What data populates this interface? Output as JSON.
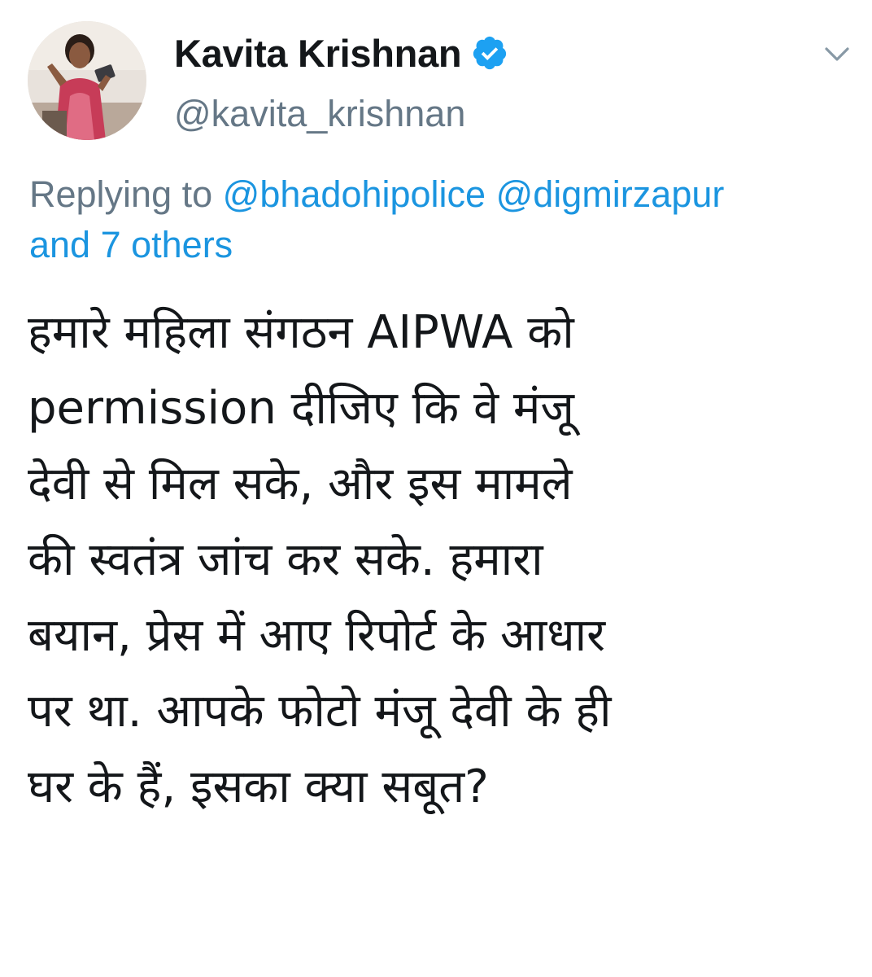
{
  "author": {
    "display_name": "Kavita Krishnan",
    "handle": "@kavita_krishnan",
    "verified": true,
    "avatar_icon": "profile-photo-avatar"
  },
  "menu": {
    "icon": "chevron-down-icon"
  },
  "reply_context": {
    "prefix": "Replying to",
    "mentions": [
      "@bhadohipolice",
      "@digmirzapur"
    ],
    "others": "and 7 others"
  },
  "tweet": {
    "lines": [
      "हमारे महिला संगठन AIPWA को",
      "permission दीजिए कि वे मंजू",
      "देवी से मिल सके, और इस मामले",
      "की स्वतंत्र जांच कर सके. हमारा",
      "बयान, प्रेस में आए रिपोर्ट के आधार",
      "पर था. आपके फोटो मंजू देवी के ही",
      "घर के हैं, इसका क्या सबूत?"
    ]
  },
  "colors": {
    "text": "#14171a",
    "secondary": "#657786",
    "link": "#1b95e0",
    "verified_badge": "#1da1f2"
  }
}
